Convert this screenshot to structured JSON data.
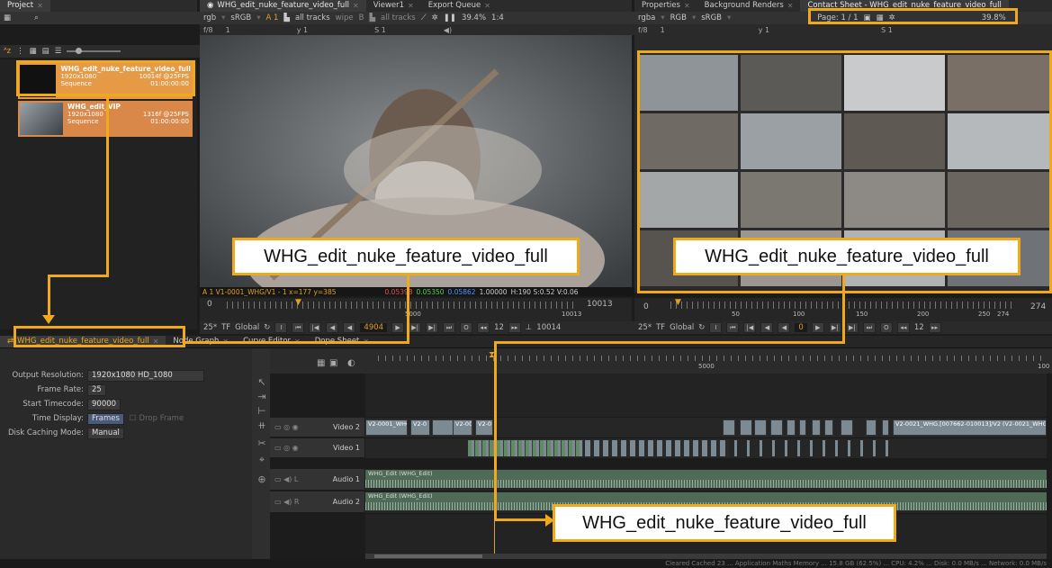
{
  "project": {
    "tab": "Project",
    "items": [
      {
        "name": "WHG_edit_nuke_feature_video_full",
        "res": "1920x1080",
        "type": "Sequence",
        "frames": "10014f @25FPS",
        "tc": "01:00:00:00"
      },
      {
        "name": "WHG_edit_VIP",
        "res": "1920x1080",
        "type": "Sequence",
        "frames": "1316f @25FPS",
        "tc": "01:00:00:00"
      }
    ]
  },
  "viewer": {
    "tabs": [
      "WHG_edit_nuke_feature_video_full",
      "Viewer1",
      "Export Queue"
    ],
    "toolbar": {
      "channels": "rgb",
      "colorspace": "sRGB",
      "input_a": "A 1",
      "tracks_a": "all tracks",
      "wipe": "wipe",
      "input_b": "B",
      "tracks_b": "all tracks",
      "zoom": "39.4%",
      "proxy": "1:4"
    },
    "sub": {
      "fstop": "f/8",
      "frame": "1",
      "gamma": "y 1",
      "sat": "S 1"
    },
    "info": {
      "clip": "A 1 V1-0001_WHG/V1 - 1 x=177 y=385",
      "r": "0.05398",
      "g": "0.05350",
      "b": "0.05862",
      "a": "1.00000",
      "hsv": "H:190 S:0.52 V:0.06"
    },
    "ruler": {
      "start": "0",
      "mid": "5000",
      "end": "10013",
      "current": "10013"
    },
    "controls": {
      "fps": "25*",
      "tf": "TF",
      "mode": "Global",
      "frame_field": "4904",
      "step": "12",
      "end_field": "10014"
    }
  },
  "contact": {
    "tabs": [
      "Properties",
      "Background Renders",
      "Contact Sheet - WHG_edit_nuke_feature_video_full"
    ],
    "toolbar": {
      "channels": "rgba",
      "lut": "RGB",
      "colorspace": "sRGB",
      "page": "Page: 1 / 1",
      "zoom": "39.8%"
    },
    "sub": {
      "fstop": "f/8",
      "frame": "1",
      "gamma": "y 1",
      "sat": "S 1"
    },
    "ruler": {
      "start": "0",
      "t1": "50",
      "t2": "100",
      "t3": "150",
      "t4": "200",
      "t5": "250",
      "t6": "274",
      "end": "274"
    },
    "controls": {
      "fps": "25*",
      "tf": "TF",
      "mode": "Global",
      "frame_field": "0",
      "step": "12"
    }
  },
  "bottom": {
    "tabs": [
      "WHG_edit_nuke_feature_video_full",
      "Node Graph",
      "Curve Editor",
      "Dope Sheet"
    ],
    "props": {
      "output_resolution_label": "Output Resolution:",
      "output_resolution": "1920x1080 HD_1080",
      "frame_rate_label": "Frame Rate:",
      "frame_rate": "25",
      "start_tc_label": "Start Timecode:",
      "start_tc": "90000",
      "time_display_label": "Time Display:",
      "time_display": "Frames",
      "drop_frame": "Drop Frame",
      "disk_cache_label": "Disk Caching Mode:",
      "disk_cache": "Manual"
    },
    "timeline": {
      "ruler_mid": "5000",
      "ruler_end": "100",
      "tracks": [
        "Video 2",
        "Video 1",
        "Audio 1",
        "Audio 2"
      ],
      "audio_labels": [
        "L",
        "R"
      ],
      "clip_v2_first": "V2-0001_WHG",
      "clip_v2_a": "V2-0",
      "clip_v2_b": "V2-000",
      "clip_v2_c": "V2-0",
      "clip_v2_last": "V2-0021_WHG.[007662-010013]/V2 (V2-0021_WHG >",
      "audio_clip": "WHG_Edit (WHG_Edit)"
    },
    "status": "Cleared Cached 23 ... Application Maths Memory ... 15.8 GB (62.5%) ... CPU: 4.2% ... Disk: 0.0 MB/s ... Network: 0.0 MB/s"
  },
  "callouts": {
    "viewer": "WHG_edit_nuke_feature_video_full",
    "contact": "WHG_edit_nuke_feature_video_full",
    "timeline": "WHG_edit_nuke_feature_video_full"
  },
  "colors": {
    "accent": "#f0a81c",
    "bin_selected": "#e79a45",
    "bin_other": "#d9884a"
  }
}
